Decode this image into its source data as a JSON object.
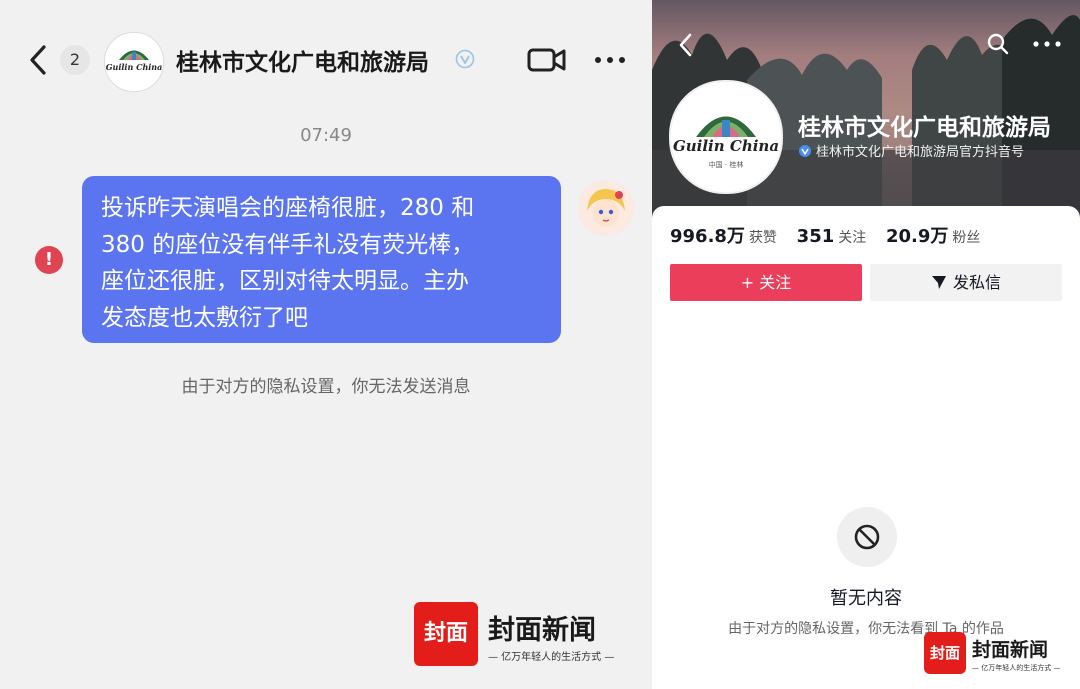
{
  "chat": {
    "unread_count": "2",
    "contact_name": "桂林市文化广电和旅游局",
    "logo_text": "Guilin China",
    "timestamp": "07:49",
    "message_lines": [
      "投诉昨天演唱会的座椅很脏，280 和",
      "380 的座位没有伴手礼没有荧光棒，",
      "座位还很脏，区别对待太明显。主办",
      "发态度也太敷衍了吧"
    ],
    "error_mark": "!",
    "privacy_notice": "由于对方的隐私设置，你无法发送消息"
  },
  "profile": {
    "name": "桂林市文化广电和旅游局",
    "verified_label": "桂林市文化广电和旅游局官方抖音号",
    "logo_text": "Guilin China",
    "logo_subtext": "中国 · 桂林",
    "stats": [
      {
        "value": "996.8万",
        "label": "获赞"
      },
      {
        "value": "351",
        "label": "关注"
      },
      {
        "value": "20.9万",
        "label": "粉丝"
      }
    ],
    "follow_label": "+ 关注",
    "message_label": "发私信",
    "empty_title": "暂无内容",
    "privacy_notice": "由于对方的隐私设置，你无法看到 Ta 的作品"
  },
  "watermark": {
    "seal": "封面",
    "title": "封面新闻",
    "slogan": "— 亿万年轻人的生活方式 —"
  },
  "colors": {
    "bubble": "#5b75f0",
    "error": "#e04452",
    "follow_button": "#ea3e5b",
    "watermark_red": "#e31d1a"
  },
  "icons": [
    "back-chevron-icon",
    "verified-icon",
    "video-call-icon",
    "more-icon",
    "error-icon",
    "search-icon",
    "send-icon",
    "blocked-icon"
  ]
}
